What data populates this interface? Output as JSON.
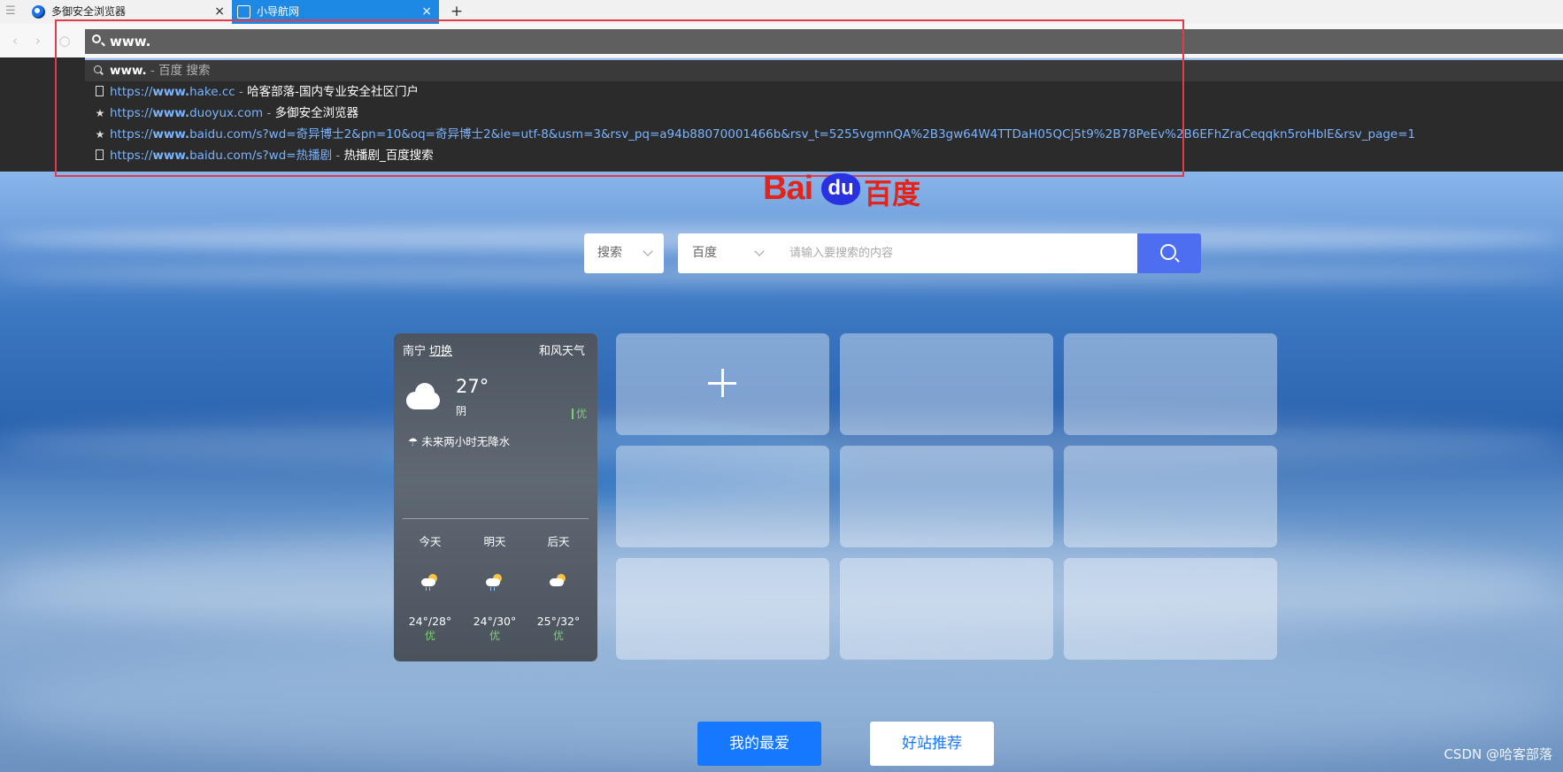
{
  "tabs": [
    {
      "label": "多御安全浏览器",
      "close": "×"
    },
    {
      "label": "小导航网",
      "close": "×"
    }
  ],
  "new_tab": "+",
  "address_bar": {
    "value": "www."
  },
  "suggestions": [
    {
      "icon": "search-icon",
      "url_bold": "www.",
      "url_rest": "",
      "sep": " - ",
      "title": "百度 搜索"
    },
    {
      "icon": "page-icon",
      "url_prefix": "https://",
      "url_bold": "www.",
      "url_rest": "hake.cc",
      "sep": " - ",
      "title": "哈客部落-国内专业安全社区门户"
    },
    {
      "icon": "star-icon",
      "url_prefix": "https://",
      "url_bold": "www.",
      "url_rest": "duoyux.com",
      "sep": " - ",
      "title": "多御安全浏览器"
    },
    {
      "icon": "star-icon",
      "url_prefix": "https://",
      "url_bold": "www.",
      "url_rest": "baidu.com/s?wd=奇异博士2&pn=10&oq=奇异博士2&ie=utf-8&usm=3&rsv_pq=a94b88070001466b&rsv_t=5255vgmnQA%2B3gw64W4TTDaH05QCj5t9%2B78PeEv%2B6EFhZraCeqqkn5roHblE&rsv_page=1",
      "sep": "",
      "title": ""
    },
    {
      "icon": "page-icon",
      "url_prefix": "https://",
      "url_bold": "www.",
      "url_rest": "baidu.com/s?wd=热播剧",
      "sep": " - ",
      "title": "热播剧_百度搜索"
    }
  ],
  "logo": {
    "bai": "Bai",
    "du": "du",
    "baidu_cn": "百度"
  },
  "search": {
    "type_label": "搜索",
    "engine_label": "百度",
    "placeholder": "请输入要搜索的内容"
  },
  "weather": {
    "city": "南宁",
    "switch": "切换",
    "source": "和风天气",
    "temp": "27°",
    "condition": "阴",
    "aqi": "优",
    "forecast_note": "未来两小时无降水",
    "days": [
      {
        "name": "今天",
        "range": "24°/28°",
        "quality": "优"
      },
      {
        "name": "明天",
        "range": "24°/30°",
        "quality": "优"
      },
      {
        "name": "后天",
        "range": "25°/32°",
        "quality": "优"
      }
    ]
  },
  "buttons": {
    "favorites": "我的最爱",
    "recommend": "好站推荐"
  },
  "watermark": "CSDN @哈客部落",
  "colors": {
    "accent": "#1677ff",
    "search_button": "#4e6ef2",
    "highlight_box": "#e23b4a",
    "baidu_red": "#e1251b",
    "baidu_blue": "#2932e1"
  }
}
